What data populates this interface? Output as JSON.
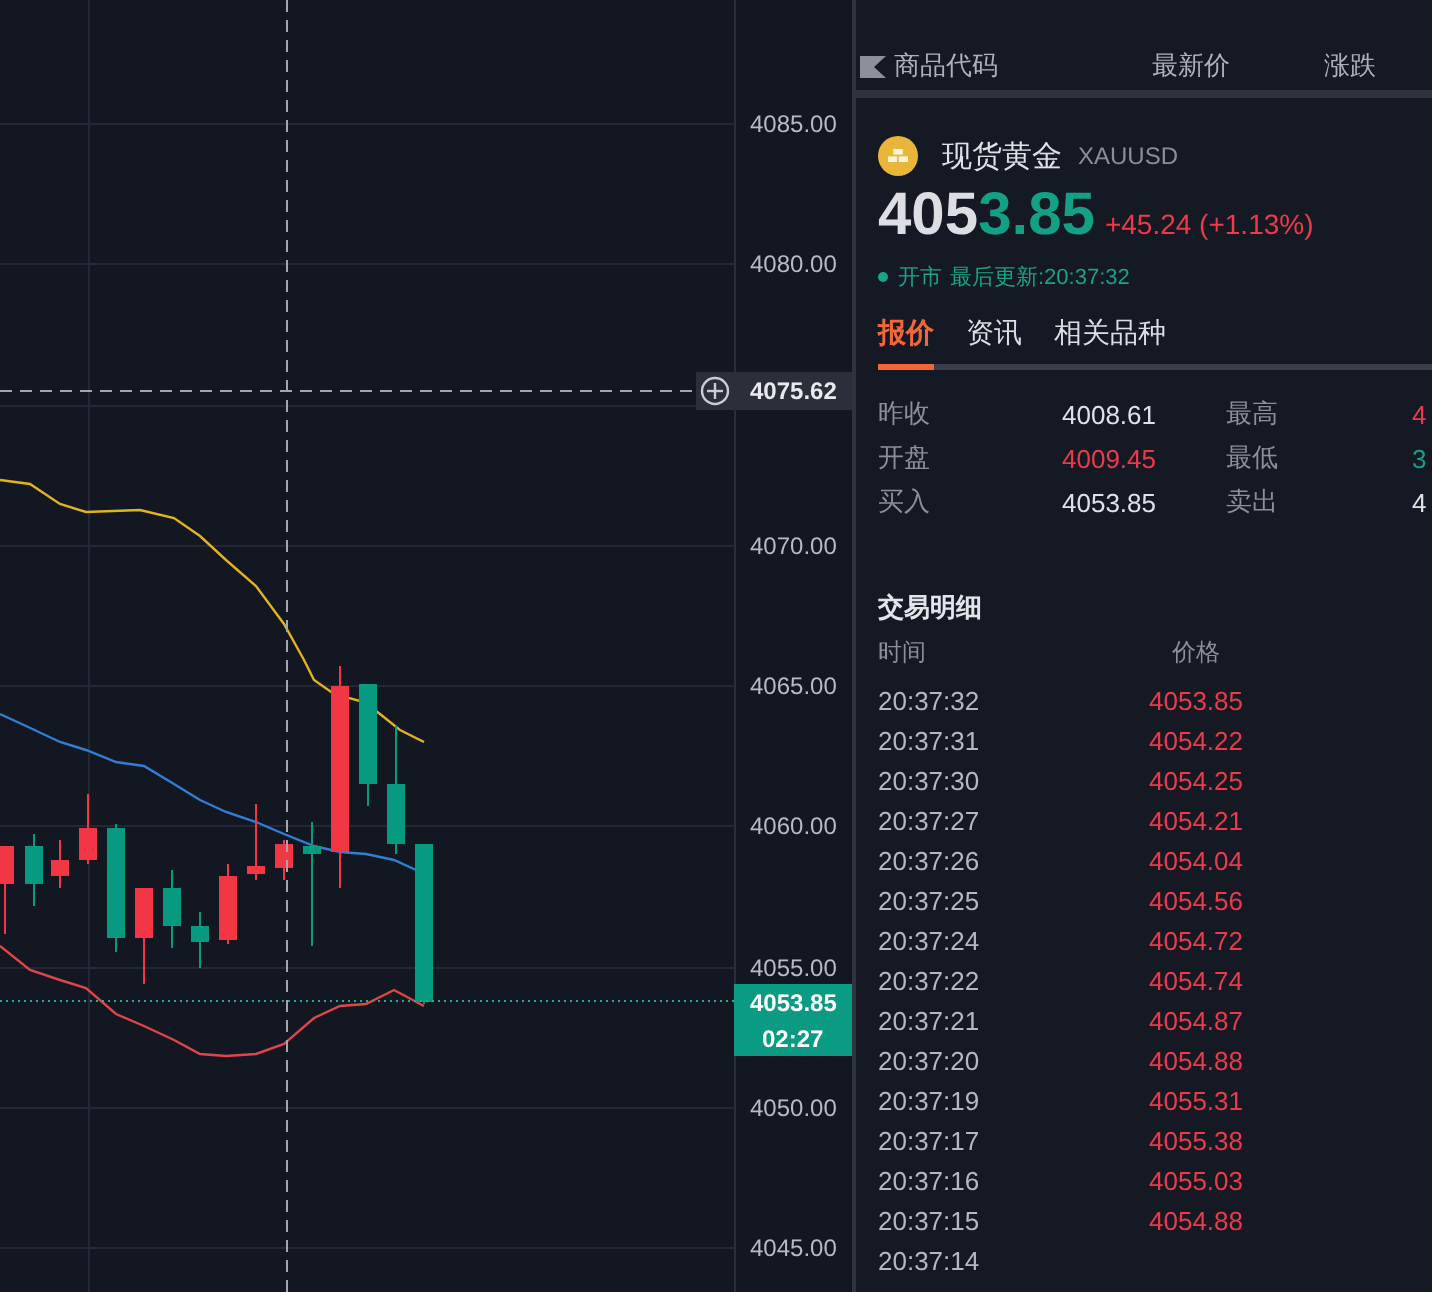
{
  "chart": {
    "price_axis": [
      "4085.00",
      "4080.00",
      "4070.00",
      "4065.00",
      "4060.00",
      "4055.00",
      "4050.00",
      "4045.00"
    ],
    "crosshair_price": "4075.62",
    "last_price": "4053.85",
    "countdown": "02:27"
  },
  "watchlist_header": {
    "columns": [
      "商品代码",
      "最新价",
      "涨跌"
    ]
  },
  "quote": {
    "name": "现货黄金",
    "symbol": "XAUUSD",
    "price_parts": [
      {
        "text": "405",
        "kind": "plain"
      },
      {
        "text": "3.85",
        "kind": "changed"
      }
    ],
    "change": "+45.24 (+1.13%)",
    "market_status": "开市",
    "last_update": "最后更新:20:37:32"
  },
  "tabs": [
    {
      "label": "报价",
      "selected": true
    },
    {
      "label": "资讯",
      "selected": false
    },
    {
      "label": "相关品种",
      "selected": false
    }
  ],
  "stats": [
    {
      "label": "昨收",
      "value": "4008.61",
      "color": "#dfe1e6"
    },
    {
      "label": "最高",
      "value": "4",
      "color": "#ec3a4b"
    },
    {
      "label": "开盘",
      "value": "4009.45",
      "color": "#ec3a4b"
    },
    {
      "label": "最低",
      "value": "3",
      "color": "#13a085"
    },
    {
      "label": "买入",
      "value": "4053.85",
      "color": "#dfe1e6"
    },
    {
      "label": "卖出",
      "value": "4",
      "color": "#dfe1e6"
    }
  ],
  "trades": {
    "title": "交易明细",
    "columns": [
      "时间",
      "价格"
    ],
    "rows": [
      {
        "time": "20:37:32",
        "price": "4053.85"
      },
      {
        "time": "20:37:31",
        "price": "4054.22"
      },
      {
        "time": "20:37:30",
        "price": "4054.25"
      },
      {
        "time": "20:37:27",
        "price": "4054.21"
      },
      {
        "time": "20:37:26",
        "price": "4054.04"
      },
      {
        "time": "20:37:25",
        "price": "4054.56"
      },
      {
        "time": "20:37:24",
        "price": "4054.72"
      },
      {
        "time": "20:37:22",
        "price": "4054.74"
      },
      {
        "time": "20:37:21",
        "price": "4054.87"
      },
      {
        "time": "20:37:20",
        "price": "4054.88"
      },
      {
        "time": "20:37:19",
        "price": "4055.31"
      },
      {
        "time": "20:37:17",
        "price": "4055.38"
      },
      {
        "time": "20:37:16",
        "price": "4055.03"
      },
      {
        "time": "20:37:15",
        "price": "4054.88"
      },
      {
        "time": "20:37:14"
      }
    ]
  }
}
